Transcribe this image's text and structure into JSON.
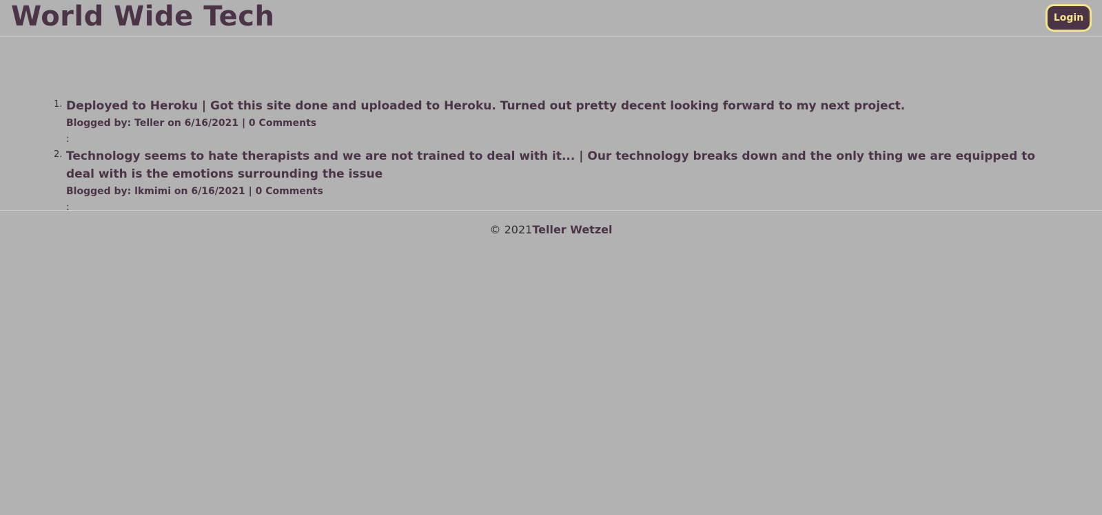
{
  "header": {
    "title": "World Wide Tech",
    "login_label": "Login"
  },
  "posts": [
    {
      "title": "Deployed to Heroku | Got this site done and uploaded to Heroku. Turned out pretty decent looking forward to my next project.",
      "meta": "Blogged by: Teller on 6/16/2021 | 0 Comments",
      "colon": ":"
    },
    {
      "title": "Technology seems to hate therapists and we are not trained to deal with it... | Our technology breaks down and the only thing we are equipped to deal with is the emotions surrounding the issue",
      "meta": "Blogged by: lkmimi on 6/16/2021 | 0 Comments",
      "colon": ":"
    }
  ],
  "footer": {
    "copyright": "© 2021",
    "name": "Teller Wetzel"
  },
  "colors": {
    "background": "#b2b2b2",
    "text": "#4a3446",
    "button_bg": "#4a3446",
    "button_accent": "#f6e48c"
  }
}
